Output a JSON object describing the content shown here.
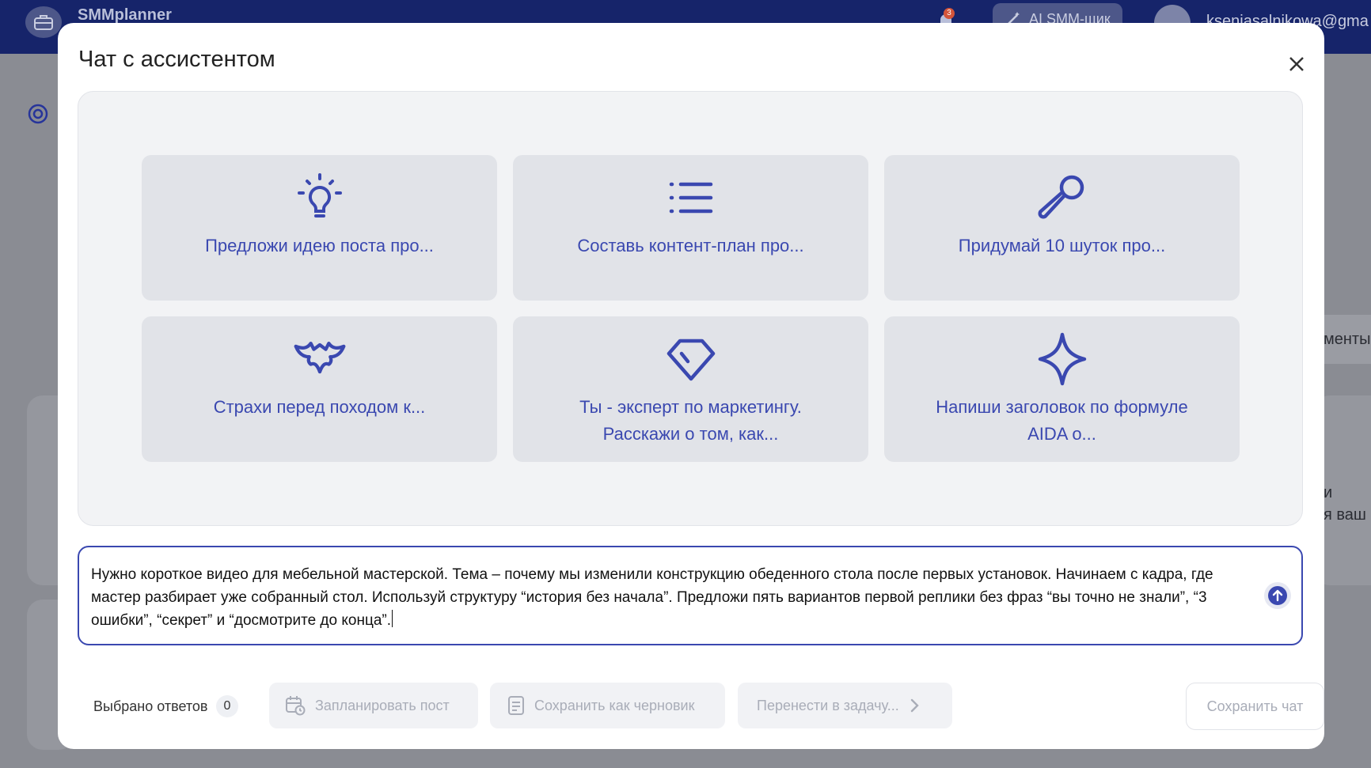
{
  "app": {
    "name": "SMMplanner",
    "notification_count": "3",
    "ai_button_label": "AI SMM-щик",
    "user_email": "kseniasalnikowa@gma",
    "right_tab_label": "менты",
    "right_card_line1": "и",
    "right_card_line2": "я ваш"
  },
  "modal": {
    "title": "Чат с ассистентом",
    "close_label": "×",
    "prompts": [
      {
        "label": "Предложи идею поста про...",
        "icon": "lightbulb-icon"
      },
      {
        "label": "Составь контент-план про...",
        "icon": "list-icon"
      },
      {
        "label": "Придумай 10 шуток про...",
        "icon": "microphone-icon"
      },
      {
        "label": "Страхи перед походом к...",
        "icon": "bat-icon"
      },
      {
        "label": "Ты - эксперт по маркетингу. Расскажи о том, как...",
        "icon": "diamond-icon"
      },
      {
        "label": "Напиши заголовок по формуле AIDA о...",
        "icon": "sparkle-icon"
      }
    ],
    "composer": {
      "value": "Нужно короткое видео для мебельной мастерской. Тема – почему мы изменили конструкцию обеденного стола после первых установок. Начинаем с кадра, где мастер разбирает уже собранный стол. Используй структуру “история без начала”. Предложи пять вариантов первой реплики без фраз “вы точно не знали”, “3 ошибки”, “секрет” и “досмотрите до конца”."
    },
    "footer": {
      "selected_label": "Выбрано ответов",
      "selected_count": "0",
      "schedule_label": "Запланировать пост",
      "draft_label": "Сохранить как черновик",
      "move_label": "Перенести в задачу...",
      "save_chat_label": "Сохранить чат"
    }
  },
  "colors": {
    "accent": "#3a48b0",
    "topbar": "#16246a",
    "card_bg": "#e1e3e8",
    "disabled_text": "#a9adb8"
  }
}
